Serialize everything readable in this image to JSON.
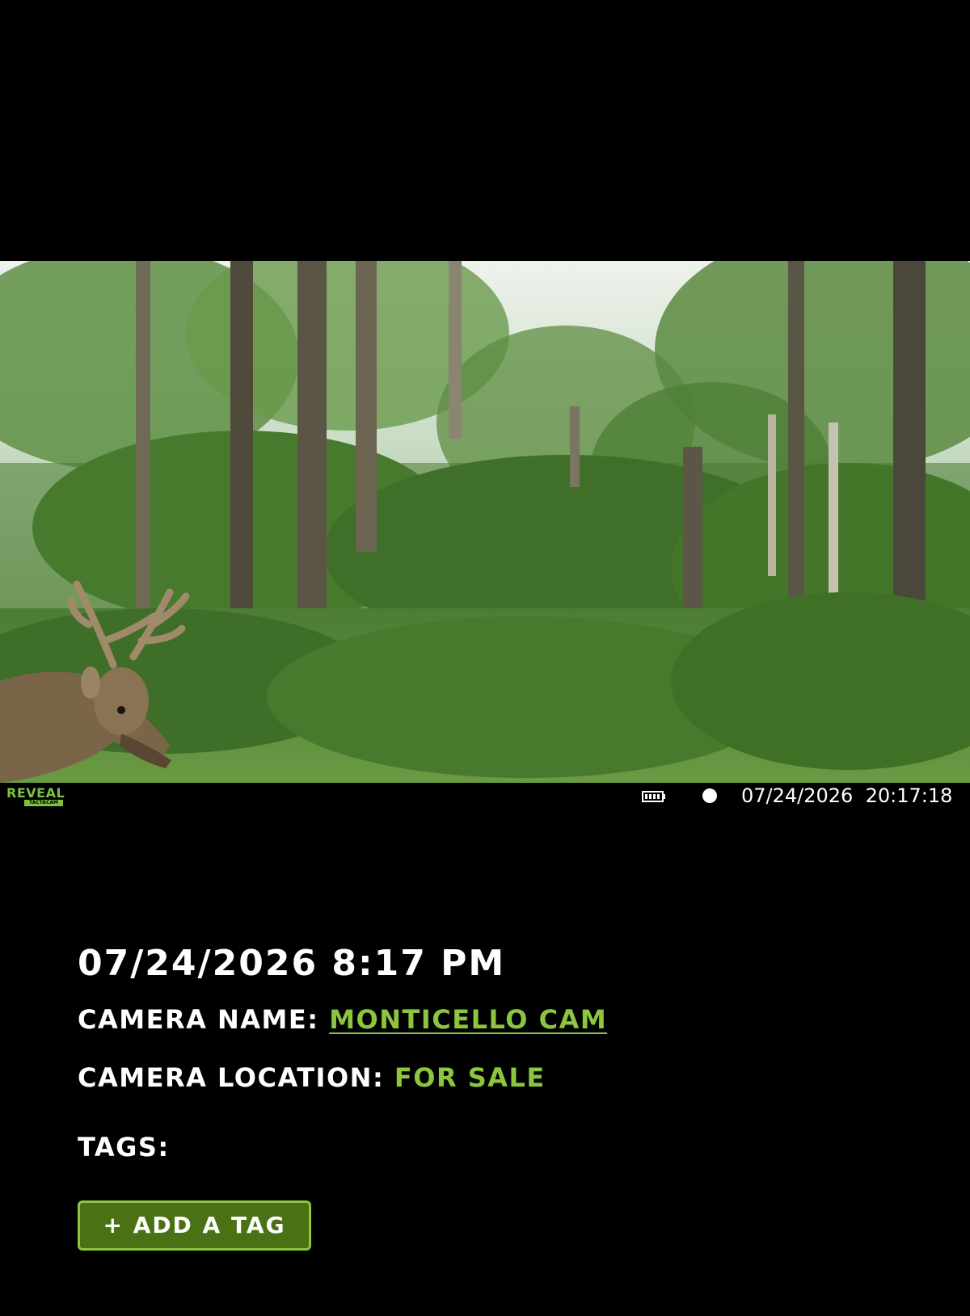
{
  "camera_overlay": {
    "brand": "REVEAL",
    "brand_sub": "TACTACAM",
    "battery_icon": "battery-icon",
    "moon_icon": "moon-phase-icon",
    "timestamp": "07/24/2026  20:17:18"
  },
  "photo": {
    "subject": "deer-photo"
  },
  "details": {
    "date_time": "07/24/2026 8:17 PM",
    "camera_name_label": "CAMERA NAME:",
    "camera_name_value": "MONTICELLO CAM",
    "camera_location_label": "CAMERA LOCATION:",
    "camera_location_value": "FOR SALE",
    "tags_label": "TAGS:",
    "add_tag_label": "+ ADD A TAG"
  },
  "colors": {
    "background": "#000000",
    "accent_green": "#8cc63f",
    "button_fill": "#4a7114",
    "text": "#ffffff"
  }
}
